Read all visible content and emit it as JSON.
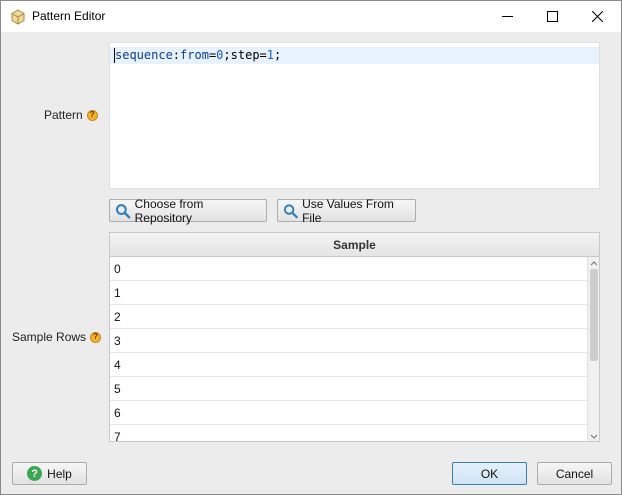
{
  "window": {
    "title": "Pattern Editor"
  },
  "pattern": {
    "label": "Pattern",
    "code_tokens": [
      {
        "text": "sequence",
        "kind": "key"
      },
      {
        "text": ":",
        "kind": "plain"
      },
      {
        "text": "from",
        "kind": "key"
      },
      {
        "text": "=",
        "kind": "plain"
      },
      {
        "text": "0",
        "kind": "num"
      },
      {
        "text": ";",
        "kind": "plain"
      },
      {
        "text": "step",
        "kind": "plain"
      },
      {
        "text": "=",
        "kind": "plain"
      },
      {
        "text": "1",
        "kind": "num"
      },
      {
        "text": ";",
        "kind": "plain"
      }
    ]
  },
  "buttons": {
    "choose_repo": "Choose from Repository",
    "use_file": "Use Values From File"
  },
  "sample": {
    "label": "Sample Rows",
    "header": "Sample",
    "rows": [
      "0",
      "1",
      "2",
      "3",
      "4",
      "5",
      "6",
      "7"
    ]
  },
  "footer": {
    "help": "Help",
    "ok": "OK",
    "cancel": "Cancel"
  },
  "colors": {
    "accent": "#3c7fb1",
    "help_badge": "#f5b125",
    "help_button_icon": "#3aa651",
    "search_icon": "#2a7bbd"
  }
}
